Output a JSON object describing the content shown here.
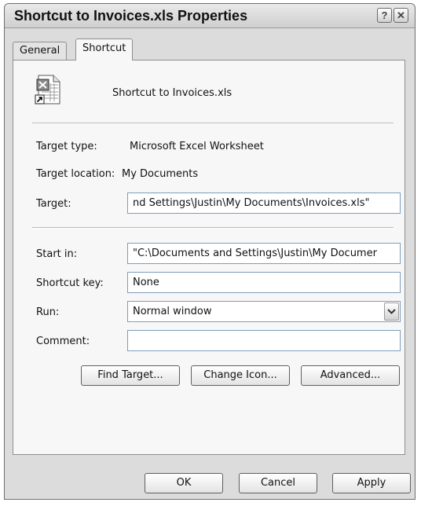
{
  "window": {
    "title": "Shortcut to Invoices.xls Properties",
    "help_glyph": "?",
    "close_glyph": "✕"
  },
  "tabs": [
    {
      "label": "General",
      "selected": false
    },
    {
      "label": "Shortcut",
      "selected": true
    }
  ],
  "shortcut": {
    "file_icon": "excel-shortcut-icon",
    "file_name": "Shortcut to Invoices.xls",
    "target_type_label": "Target type:",
    "target_type_value": "Microsoft Excel Worksheet",
    "target_location_label": "Target location:",
    "target_location_value": "My Documents",
    "target_label": "Target:",
    "target_value": "nd Settings\\Justin\\My Documents\\Invoices.xls\"",
    "start_in_label": "Start in:",
    "start_in_value": "\"C:\\Documents and Settings\\Justin\\My Documer",
    "shortcut_key_label": "Shortcut key:",
    "shortcut_key_value": "None",
    "run_label": "Run:",
    "run_value": "Normal window",
    "comment_label": "Comment:",
    "comment_value": ""
  },
  "action_buttons": {
    "find_target": "Find Target...",
    "change_icon": "Change Icon...",
    "advanced": "Advanced..."
  },
  "footer_buttons": {
    "ok": "OK",
    "cancel": "Cancel",
    "apply": "Apply"
  }
}
